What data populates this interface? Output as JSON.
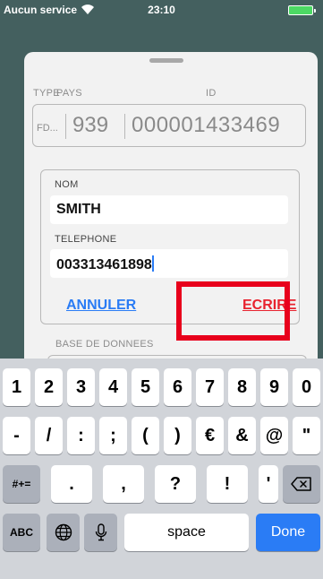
{
  "status_bar": {
    "carrier": "Aucun service",
    "time": "23:10"
  },
  "id_section": {
    "label_type": "TYPE",
    "label_pays": "PAYS",
    "label_id": "ID",
    "type_value": "FD...",
    "pays_value": "939",
    "id_value": "000001433469"
  },
  "dialog": {
    "nom_label": "NOM",
    "nom_value": "SMITH",
    "telephone_label": "TELEPHONE",
    "telephone_value": "003313461898",
    "cancel_label": "ANNULER",
    "write_label": "ECRIRE"
  },
  "database": {
    "label": "BASE DE DONNEES"
  },
  "keyboard": {
    "row1": [
      "1",
      "2",
      "3",
      "4",
      "5",
      "6",
      "7",
      "8",
      "9",
      "0"
    ],
    "row2": [
      "-",
      "/",
      ":",
      ";",
      "(",
      ")",
      "€",
      "&",
      "@",
      "\""
    ],
    "row3_symbols": "#+=",
    "row3": [
      ".",
      ",",
      "?",
      "!",
      "'"
    ],
    "row4_abc": "ABC",
    "space_label": "space",
    "done_label": "Done"
  }
}
